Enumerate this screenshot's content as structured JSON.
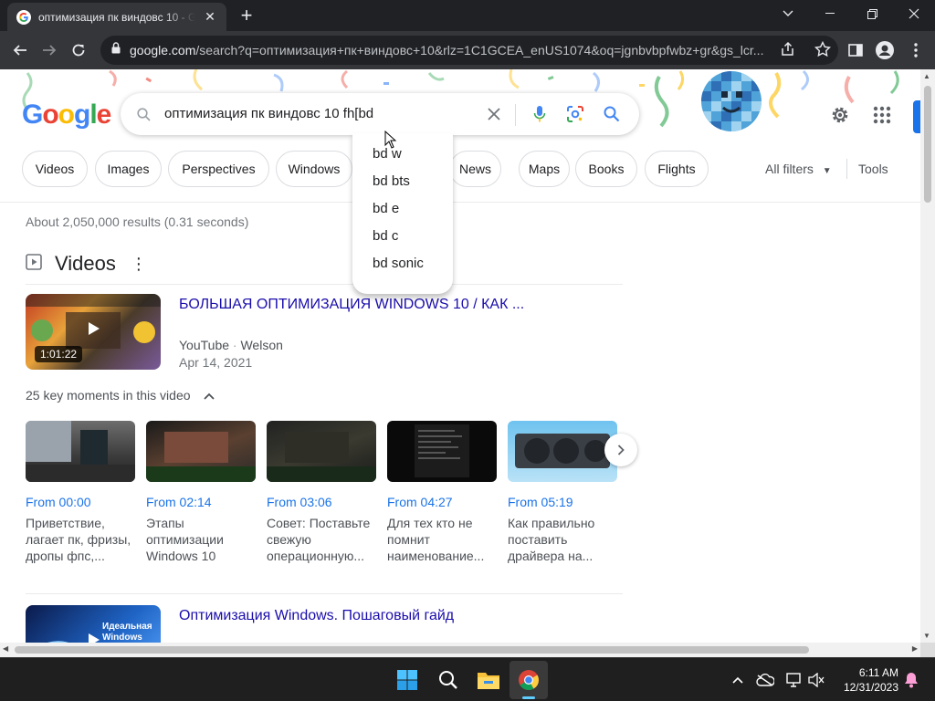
{
  "browser": {
    "tab_title": "оптимизация пк виндовс 10 - G",
    "url_domain": "google.com",
    "url_rest": "/search?q=оптимизация+пк+виндовс+10&rlz=1C1GCEA_enUS1074&oq=jgnbvbpfwbz+gr&gs_lcr...",
    "tab_close": "✕",
    "new_tab": "+"
  },
  "search": {
    "logo_letters": [
      "G",
      "o",
      "o",
      "g",
      "l",
      "e"
    ],
    "logo_colors": [
      "#4285f4",
      "#ea4335",
      "#fbbc05",
      "#4285f4",
      "#34a853",
      "#ea4335"
    ],
    "query": "оптимизация пк виндовс 10 fh[bd",
    "suggestions": [
      "bd w",
      "bd bts",
      "bd e",
      "bd c",
      "bd sonic"
    ]
  },
  "filters": {
    "chips": [
      "Videos",
      "Images",
      "Perspectives",
      "Windows",
      "News",
      "Maps",
      "Books",
      "Flights"
    ],
    "all_filters": "All filters",
    "tools": "Tools"
  },
  "results": {
    "stats": "About 2,050,000 results (0.31 seconds)",
    "videos_heading": "Videos",
    "video1": {
      "title": "БОЛЬШАЯ ОПТИМИЗАЦИЯ WINDOWS 10 / КАК ...",
      "source": "YouTube",
      "author": "Welson",
      "date": "Apr 14, 2021",
      "duration": "1:01:22"
    },
    "key_moments_label": "25 key moments in this video",
    "moments": [
      {
        "from": "From 00:00",
        "desc": "Приветствие, лагает пк, фризы, дропы фпс,..."
      },
      {
        "from": "From 02:14",
        "desc": "Этапы оптимизации Windows 10"
      },
      {
        "from": "From 03:06",
        "desc": "Совет: Поставьте свежую операционную..."
      },
      {
        "from": "From 04:27",
        "desc": "Для тех кто не помнит наименование..."
      },
      {
        "from": "From 05:19",
        "desc": "Как правильно поставить драйвера на..."
      }
    ],
    "video2": {
      "title": "Оптимизация Windows. Пошаговый гайд",
      "thumb_text": "Идеальная Windows"
    }
  },
  "taskbar": {
    "time": "6:11 AM",
    "date": "12/31/2023"
  },
  "colors": {
    "link": "#1a0dab",
    "accent": "#1a73e8",
    "chrome_dark": "#202124"
  }
}
